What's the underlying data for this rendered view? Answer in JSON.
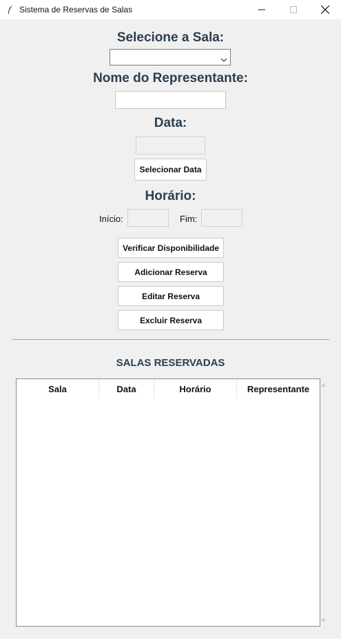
{
  "window": {
    "title": "Sistema de Reservas de Salas"
  },
  "form": {
    "sala_label": "Selecione a Sala:",
    "sala_value": "",
    "nome_label": "Nome do Representante:",
    "nome_value": "",
    "data_label": "Data:",
    "data_value": "",
    "selecionar_data": "Selecionar Data",
    "horario_label": "Horário:",
    "inicio_label": "Início:",
    "inicio_value": "",
    "fim_label": "Fim:",
    "fim_value": ""
  },
  "actions": {
    "verificar": "Verificar Disponibilidade",
    "adicionar": "Adicionar Reserva",
    "editar": "Editar Reserva",
    "excluir": "Excluir Reserva"
  },
  "reservas": {
    "title": "SALAS RESERVADAS",
    "columns": [
      "Sala",
      "Data",
      "Horário",
      "Representante"
    ],
    "rows": []
  }
}
